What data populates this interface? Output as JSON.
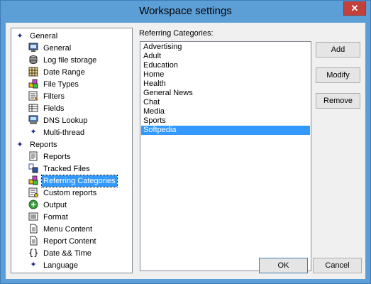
{
  "window": {
    "title": "Workspace settings",
    "close_glyph": "✕"
  },
  "tree": {
    "groups": [
      {
        "label": "General",
        "items": [
          {
            "label": "General",
            "icon": "computer-icon"
          },
          {
            "label": "Log file storage",
            "icon": "disk-icon"
          },
          {
            "label": "Date Range",
            "icon": "calendar-icon"
          },
          {
            "label": "File Types",
            "icon": "file-types-icon"
          },
          {
            "label": "Filters",
            "icon": "filter-icon"
          },
          {
            "label": "Fields",
            "icon": "fields-icon"
          },
          {
            "label": "DNS Lookup",
            "icon": "dns-icon"
          },
          {
            "label": "Multi-thread",
            "icon": "diamond-icon"
          }
        ]
      },
      {
        "label": "Reports",
        "items": [
          {
            "label": "Reports",
            "icon": "reports-icon"
          },
          {
            "label": "Tracked Files",
            "icon": "tracked-files-icon"
          },
          {
            "label": "Referring Categories",
            "icon": "categories-icon",
            "selected": true
          },
          {
            "label": "Custom reports",
            "icon": "custom-reports-icon"
          },
          {
            "label": "Output",
            "icon": "output-icon"
          },
          {
            "label": "Format",
            "icon": "format-icon"
          },
          {
            "label": "Menu Content",
            "icon": "document-icon"
          },
          {
            "label": "Report Content",
            "icon": "document-icon"
          },
          {
            "label": "Date && Time",
            "icon": "braces-icon"
          },
          {
            "label": "Language",
            "icon": "diamond-icon"
          }
        ]
      }
    ]
  },
  "categories": {
    "label": "Referring Categories:",
    "items": [
      "Advertising",
      "Adult",
      "Education",
      "Home",
      "Health",
      "General News",
      "Chat",
      "Media",
      "Sports",
      "Softpedia"
    ],
    "selected_index": 9
  },
  "buttons": {
    "add": "Add",
    "modify": "Modify",
    "remove": "Remove",
    "ok": "OK",
    "cancel": "Cancel"
  },
  "colors": {
    "selection": "#3399ff",
    "title_bar": "#5c9ed6",
    "close": "#c4403a"
  }
}
